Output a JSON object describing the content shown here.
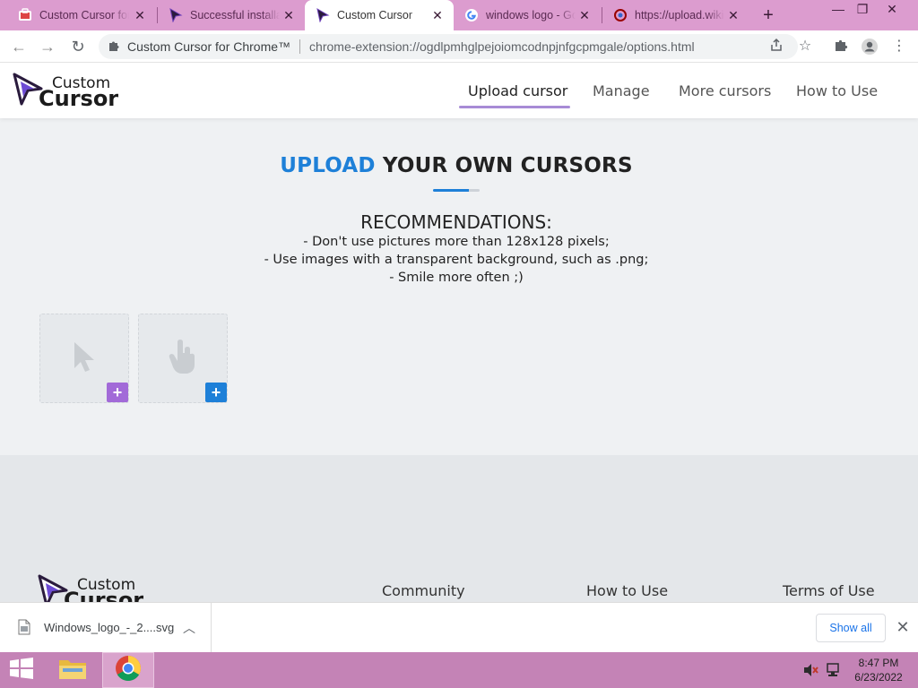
{
  "browser": {
    "tabs": [
      {
        "title": "Custom Cursor for Chrome",
        "favicon": "custom-cursor-store-icon",
        "active": false
      },
      {
        "title": "Successful installation",
        "favicon": "cursor-arrow-icon",
        "active": false
      },
      {
        "title": "Custom Cursor",
        "favicon": "cursor-arrow-icon",
        "active": true
      },
      {
        "title": "windows logo - Google Search",
        "favicon": "google-g-icon",
        "active": false
      },
      {
        "title": "https://upload.wikimedia.org",
        "favicon": "wikimedia-icon",
        "active": false
      }
    ],
    "new_tab": "+",
    "omnibox": {
      "site_name": "Custom Cursor for Chrome™",
      "url": "chrome-extension://ogdlpmhglpejoiomcodnpjnfgcpmgale/options.html"
    },
    "colors": {
      "frame": "#dc9ccf"
    }
  },
  "site": {
    "logo_top": "Custom",
    "logo_bottom": "Cursor",
    "nav": [
      {
        "label": "Upload cursor",
        "active": true
      },
      {
        "label": "Manage",
        "active": false
      },
      {
        "label": "More cursors",
        "active": false
      },
      {
        "label": "How to Use",
        "active": false
      }
    ],
    "title_accent": "UPLOAD",
    "title_rest": "YOUR OWN CURSORS",
    "rec_heading": "RECOMMENDATIONS:",
    "rec_lines": [
      "- Don't use pictures more than 128x128 pixels;",
      "- Use images with a transparent background, such as .png;",
      "- Smile more often ;)"
    ],
    "upload_slots": [
      {
        "kind": "pointer",
        "icon": "arrow-cursor-icon",
        "plus_color": "#a26ad8"
      },
      {
        "kind": "hand",
        "icon": "hand-cursor-icon",
        "plus_color": "#1e80d8"
      }
    ],
    "footer_links": [
      "Community",
      "How to Use",
      "Terms of Use"
    ],
    "colors": {
      "accent": "#1e80d8",
      "nav_underline": "#a78bd6",
      "page_bg": "#eff1f3"
    }
  },
  "downloads": {
    "file": "Windows_logo_-_2....svg",
    "show_all": "Show all"
  },
  "taskbar": {
    "time": "8:47 PM",
    "date": "6/23/2022",
    "color": "#c483b6"
  }
}
